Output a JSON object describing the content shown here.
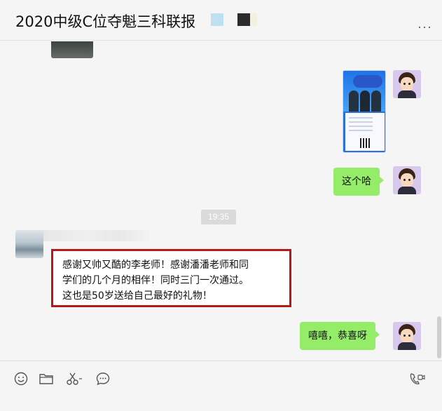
{
  "header": {
    "title": "2020中级C位夺魁三科联报",
    "more_icon": "more-dots-icon"
  },
  "messages": {
    "image_poster": {
      "badge_line1": "中级@升学!",
      "badge_line2": "全部不难 随时学"
    },
    "reply_1": "这个哈",
    "timestamp": "19:35",
    "incoming": {
      "line1": "感谢又帅又酷的李老师！感谢潘潘老师和同",
      "line2": "学们的几个月的相伴！同时三门一次通过。",
      "line3": "这也是50岁送给自己最好的礼物！"
    },
    "reply_2": "嘻嘻，恭喜呀"
  },
  "toolbar": {
    "icons": [
      "emoji-icon",
      "folder-icon",
      "scissors-icon",
      "chat-history-icon",
      "video-call-icon"
    ]
  },
  "colors": {
    "my_bubble": "#95ec69",
    "highlight_border": "#b31b1b",
    "background": "#f5f5f5"
  }
}
